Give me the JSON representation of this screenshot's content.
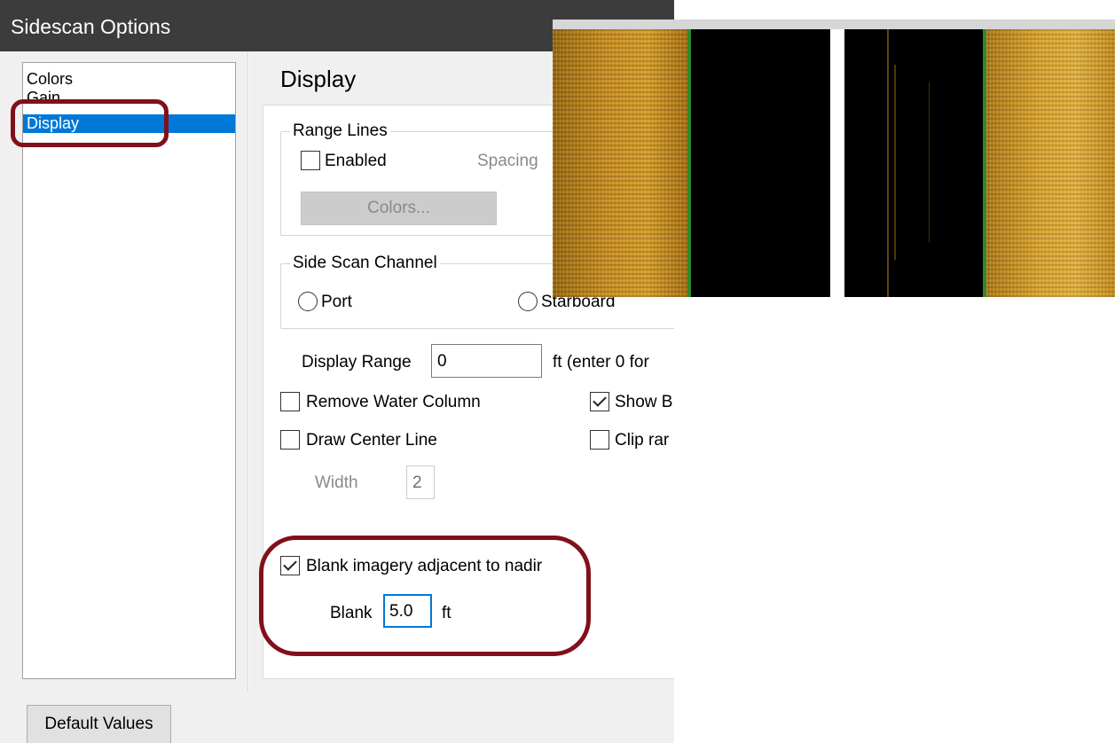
{
  "window": {
    "title": "Sidescan Options"
  },
  "categories": {
    "items": [
      {
        "label": "Colors"
      },
      {
        "label": "Gain"
      },
      {
        "label": "Display",
        "selected": true
      }
    ]
  },
  "page": {
    "heading": "Display"
  },
  "range_lines": {
    "group_label": "Range Lines",
    "enabled_label": "Enabled",
    "enabled_checked": false,
    "spacing_label": "Spacing",
    "colors_button_label": "Colors..."
  },
  "side_scan_channel": {
    "group_label": "Side Scan Channel",
    "port_label": "Port",
    "starboard_label": "Starboard"
  },
  "display_range": {
    "label": "Display Range",
    "value": "0",
    "hint": "ft (enter 0 for"
  },
  "options": {
    "remove_water_column": {
      "label": "Remove Water Column",
      "checked": false
    },
    "show_b": {
      "label": "Show B",
      "checked": true
    },
    "draw_center_line": {
      "label": "Draw Center Line",
      "checked": false
    },
    "clip_range": {
      "label": "Clip rar",
      "checked": false
    },
    "width_label": "Width",
    "width_value": "2"
  },
  "blank_nadir": {
    "label": "Blank imagery adjacent to nadir",
    "checked": true,
    "blank_label": "Blank",
    "blank_value": "5.0",
    "unit": "ft"
  },
  "footer": {
    "default_values_label": "Default Values"
  },
  "colors": {
    "title_bar": "#3c3c3c",
    "selection": "#0078d7",
    "highlight_ring": "#80101a",
    "sonar_sand": "#d09a2a",
    "sonar_edge": "#2e8a2e"
  }
}
